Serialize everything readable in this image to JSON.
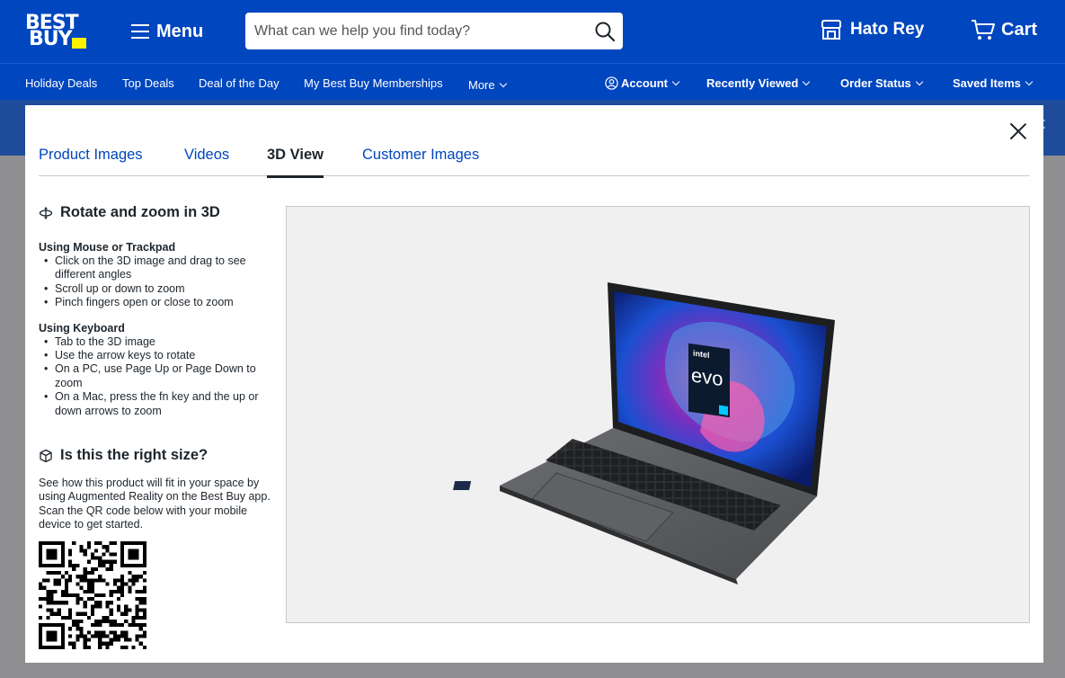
{
  "header": {
    "logo_line1": "BEST",
    "logo_line2": "BUY",
    "menu_label": "Menu",
    "search_placeholder": "What can we help you find today?",
    "store_label": "Hato Rey",
    "cart_label": "Cart"
  },
  "nav": {
    "left": [
      "Holiday Deals",
      "Top Deals",
      "Deal of the Day",
      "My Best Buy Memberships",
      "More"
    ],
    "right": [
      "Account",
      "Recently Viewed",
      "Order Status",
      "Saved Items"
    ]
  },
  "background_partial_text": "rt",
  "modal": {
    "tabs": [
      "Product Images",
      "Videos",
      "3D View",
      "Customer Images"
    ],
    "active_tab": "3D View",
    "rotate_heading": "Rotate and zoom in 3D",
    "mouse_title": "Using Mouse or Trackpad",
    "mouse_steps": [
      "Click on the 3D image and drag to see different angles",
      "Scroll up or down to zoom",
      "Pinch fingers open or close to zoom"
    ],
    "keyboard_title": "Using Keyboard",
    "keyboard_steps": [
      "Tab to the 3D image",
      "Use the arrow keys to rotate",
      "On a PC, use Page Up or Page Down to zoom",
      "On a Mac, press the fn key and the up or down arrows to zoom"
    ],
    "size_heading": "Is this the right size?",
    "size_description": "See how this product will fit in your space by using Augmented Reality on the Best Buy app. Scan the QR code below with your mobile device to get started.",
    "sticker_brand": "intel",
    "sticker_text": "evo"
  },
  "colors": {
    "brand_blue": "#0046be",
    "brand_yellow": "#fff200",
    "text_dark": "#1d252c"
  }
}
